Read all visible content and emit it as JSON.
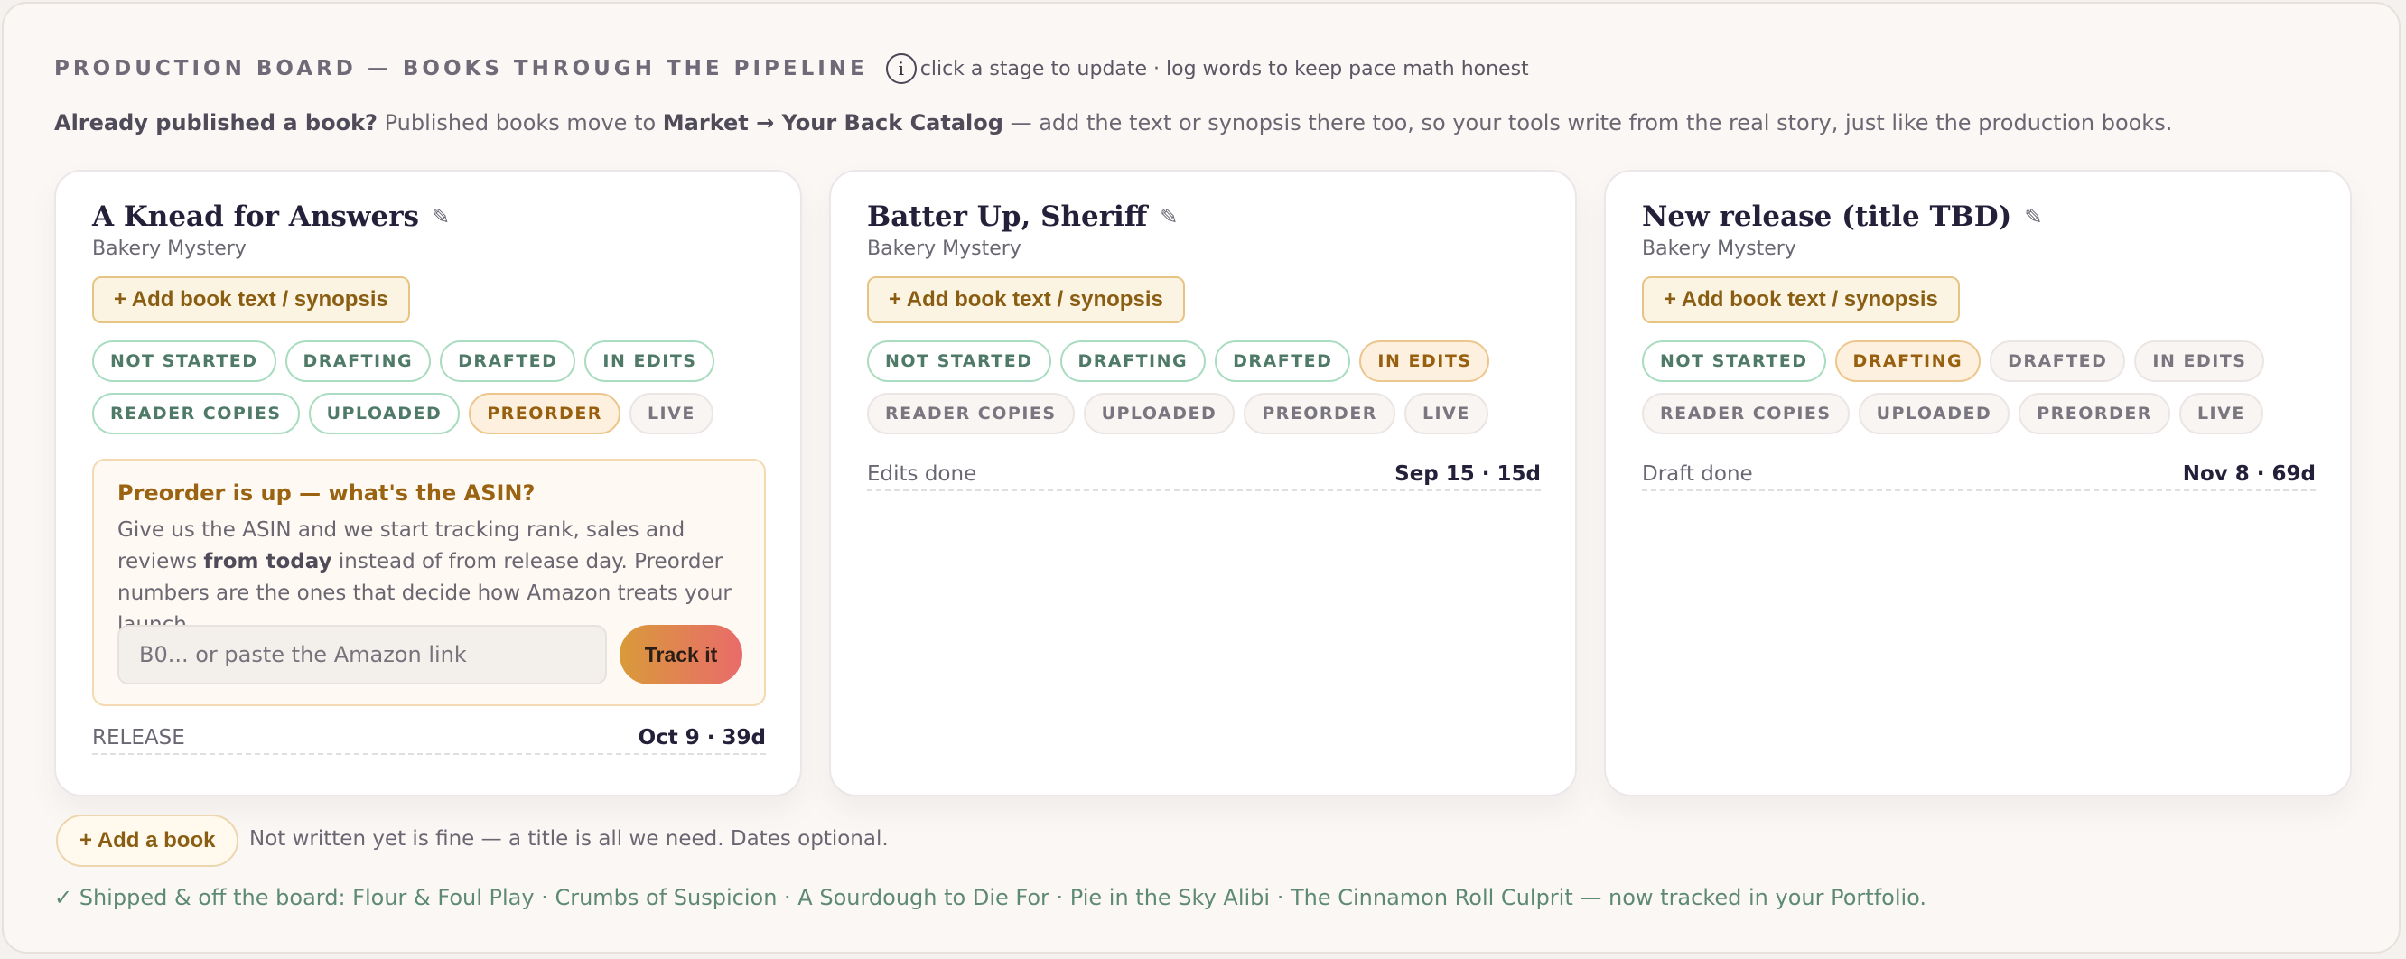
{
  "header": {
    "title": "PRODUCTION BOARD — BOOKS THROUGH THE PIPELINE",
    "info_icon": "i",
    "hint": "click a stage to update · log words to keep pace math honest"
  },
  "note": {
    "bold1": "Already published a book?",
    "text1": " Published books move to ",
    "bold2": "Market → Your Back Catalog",
    "text2": " — add the text or synopsis there too, so your tools write from the real story, just like the production books."
  },
  "cards": [
    {
      "title": "A Knead for Answers",
      "genre": "Bakery Mystery",
      "add_text_label": "+ Add book text / synopsis",
      "stages_row1": [
        "NOT STARTED",
        "DRAFTING",
        "DRAFTED",
        "IN EDITS"
      ],
      "stages_row2": [
        "READER COPIES",
        "UPLOADED",
        "PREORDER",
        "LIVE"
      ],
      "current_stage": "PREORDER",
      "asin": {
        "heading": "Preorder is up — what's the ASIN?",
        "body1": "Give us the ASIN and we start tracking rank, sales and reviews ",
        "body_bold": "from today",
        "body2": " instead of from release day. Preorder numbers are the ones that decide how Amazon treats your launch.",
        "placeholder": "B0... or paste the Amazon link",
        "button": "Track it"
      },
      "deadline_label": "RELEASE",
      "deadline_value": "Oct 9 · 39d"
    },
    {
      "title": "Batter Up, Sheriff",
      "genre": "Bakery Mystery",
      "add_text_label": "+ Add book text / synopsis",
      "stages_row1": [
        "NOT STARTED",
        "DRAFTING",
        "DRAFTED",
        "IN EDITS"
      ],
      "stages_row2": [
        "READER COPIES",
        "UPLOADED",
        "PREORDER",
        "LIVE"
      ],
      "current_stage": "IN EDITS",
      "deadline_label": "Edits done",
      "deadline_value": "Sep 15 · 15d"
    },
    {
      "title": "New release (title TBD)",
      "genre": "Bakery Mystery",
      "add_text_label": "+ Add book text / synopsis",
      "stages_row1": [
        "NOT STARTED",
        "DRAFTING",
        "DRAFTED",
        "IN EDITS"
      ],
      "stages_row2": [
        "READER COPIES",
        "UPLOADED",
        "PREORDER",
        "LIVE"
      ],
      "current_stage": "DRAFTING",
      "deadline_label": "Draft done",
      "deadline_value": "Nov 8 · 69d"
    }
  ],
  "footer": {
    "add_book": "+ Add a book",
    "add_book_hint": "Not written yet is fine — a title is all we need. Dates optional.",
    "shipped": "✓ Shipped & off the board: Flour & Foul Play · Crumbs of Suspicion · A Sourdough to Die For · Pie in the Sky Alibi · The Cinnamon Roll Culprit — now tracked in your Portfolio."
  },
  "icons": {
    "pencil": "pencil-icon",
    "info": "info-icon"
  }
}
